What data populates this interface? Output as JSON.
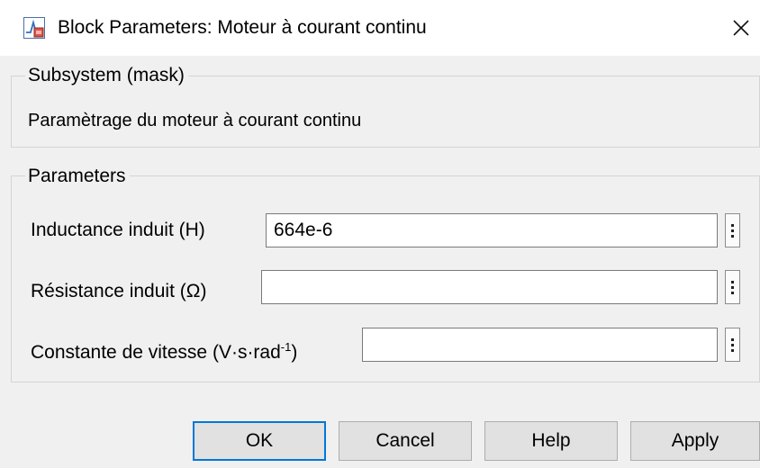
{
  "window": {
    "title": "Block Parameters: Moteur à courant continu"
  },
  "mask_group": {
    "label": "Subsystem (mask)",
    "description": "Paramètrage du moteur à courant continu"
  },
  "parameters_group": {
    "label": "Parameters",
    "fields": [
      {
        "label": "Inductance induit (H)",
        "value": ""
      },
      {
        "label": "Résistance induit (Ω)",
        "value": ""
      },
      {
        "label_main": "Constante de vitesse (V·s·rad",
        "label_sup": "-1",
        "label_end": ")",
        "value": ""
      }
    ]
  },
  "inductance_value": "664e-6",
  "buttons": {
    "ok": "OK",
    "cancel": "Cancel",
    "help": "Help",
    "apply": "Apply"
  }
}
